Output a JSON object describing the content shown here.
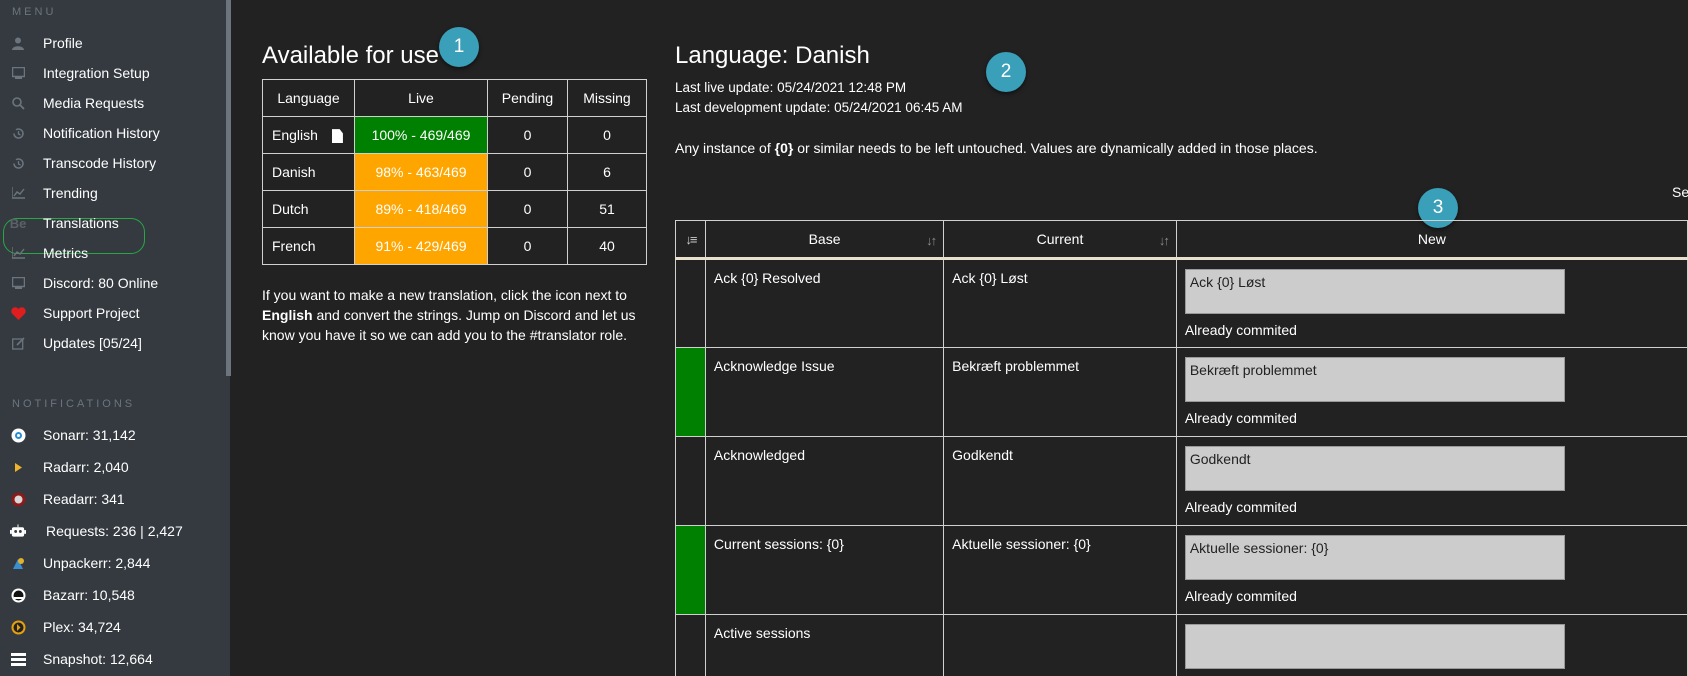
{
  "sidebar": {
    "menu_heading": "MENU",
    "menu_items": [
      {
        "label": "Profile",
        "icon": "user-icon"
      },
      {
        "label": "Integration Setup",
        "icon": "plug-icon"
      },
      {
        "label": "Media Requests",
        "icon": "search-icon"
      },
      {
        "label": "Notification History",
        "icon": "history-icon"
      },
      {
        "label": "Transcode History",
        "icon": "history-icon"
      },
      {
        "label": "Trending",
        "icon": "chart-line-icon"
      },
      {
        "label": "Translations",
        "icon": "behance-icon",
        "icon_text": "Be"
      },
      {
        "label": "Metrics",
        "icon": "chart-line-icon"
      },
      {
        "label": "Discord: 80 Online",
        "icon": "discord-icon"
      },
      {
        "label": "Support Project",
        "icon": "heart-icon"
      },
      {
        "label": "Updates [05/24]",
        "icon": "edit-icon"
      }
    ],
    "notifications_heading": "NOTIFICATIONS",
    "notification_items": [
      {
        "label": "Sonarr: 31,142",
        "icon": "sonarr-icon"
      },
      {
        "label": "Radarr: 2,040",
        "icon": "radarr-icon"
      },
      {
        "label": "Readarr: 341",
        "icon": "readarr-icon"
      },
      {
        "label": "Requests: 236 | 2,427",
        "icon": "robot-icon"
      },
      {
        "label": "Unpackerr: 2,844",
        "icon": "unpackerr-icon"
      },
      {
        "label": "Bazarr: 10,548",
        "icon": "bazarr-icon"
      },
      {
        "label": "Plex: 34,724",
        "icon": "plex-icon"
      },
      {
        "label": "Snapshot: 12,664",
        "icon": "snapshot-icon"
      }
    ]
  },
  "available": {
    "title": "Available for use",
    "badge": "1",
    "headers": [
      "Language",
      "Live",
      "Pending",
      "Missing"
    ],
    "rows": [
      {
        "language": "English",
        "live": "100% - 469/469",
        "pending": "0",
        "missing": "0",
        "status": "green"
      },
      {
        "language": "Danish",
        "live": "98% - 463/469",
        "pending": "0",
        "missing": "6",
        "status": "orange"
      },
      {
        "language": "Dutch",
        "live": "89% - 418/469",
        "pending": "0",
        "missing": "51",
        "status": "orange"
      },
      {
        "language": "French",
        "live": "91% - 429/469",
        "pending": "0",
        "missing": "40",
        "status": "orange"
      }
    ],
    "help_part1": "If you want to make a new translation, click the icon next to ",
    "help_bold": "English",
    "help_part2": " and convert the strings. Jump on Discord and let us know you have it so we can add you to the #translator role."
  },
  "language_panel": {
    "title": "Language: Danish",
    "badge": "2",
    "last_live": "Last live update: 05/24/2021 12:48 PM",
    "last_dev": "Last development update: 05/24/2021 06:45 AM",
    "note_part1": "Any instance of ",
    "note_bold": "{0}",
    "note_part2": " or similar needs to be left untouched. Values are dynamically added in those places.",
    "fragment": "Se",
    "badge3": "3",
    "columns": [
      "Base",
      "Current",
      "New"
    ],
    "rows": [
      {
        "base": "Ack {0} Resolved",
        "current": "Ack {0} Løst",
        "new_value": "Ack {0} Løst",
        "committed": "Already commited",
        "status": "none"
      },
      {
        "base": "Acknowledge Issue",
        "current": "Bekræft problemmet",
        "new_value": "Bekræft problemmet",
        "committed": "Already commited",
        "status": "green"
      },
      {
        "base": "Acknowledged",
        "current": "Godkendt",
        "new_value": "Godkendt",
        "committed": "Already commited",
        "status": "none"
      },
      {
        "base": "Current sessions: {0}",
        "current": "Aktuelle sessioner: {0}",
        "new_value": "Aktuelle sessioner: {0}",
        "committed": "Already commited",
        "status": "green"
      },
      {
        "base": "Active sessions",
        "current": "",
        "new_value": "",
        "committed": "",
        "status": "none"
      }
    ]
  },
  "colors": {
    "sidebar_bg": "#343a40",
    "main_bg": "#222222",
    "live_full": "#008000",
    "live_partial": "#ffa500",
    "badge": "#3a9fb8",
    "active_outline": "#28a745"
  }
}
